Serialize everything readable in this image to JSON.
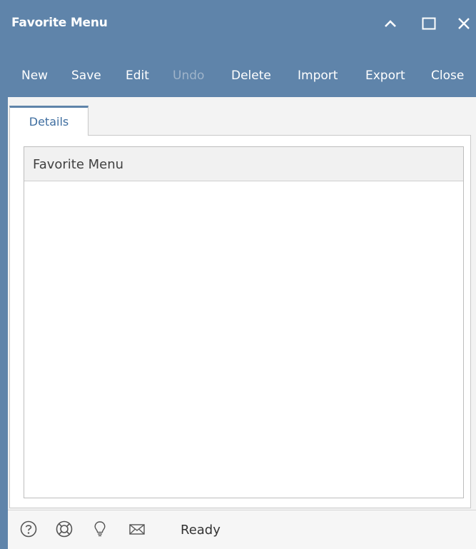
{
  "window": {
    "title": "Favorite Menu",
    "controls": [
      "collapse-icon",
      "maximize-icon",
      "close-icon"
    ],
    "accent_color": "#5f84aa"
  },
  "toolbar": {
    "new_label": "New",
    "save_label": "Save",
    "edit_label": "Edit",
    "undo_label": "Undo",
    "undo_disabled": true,
    "delete_label": "Delete",
    "import_label": "Import",
    "export_label": "Export",
    "close_label": "Close"
  },
  "tabs": [
    {
      "label": "Details",
      "active": true
    }
  ],
  "grid": {
    "header": "Favorite Menu",
    "rows": []
  },
  "statusbar": {
    "icons": [
      "help-icon",
      "support-icon",
      "idea-icon",
      "mail-icon"
    ],
    "status": "Ready"
  }
}
